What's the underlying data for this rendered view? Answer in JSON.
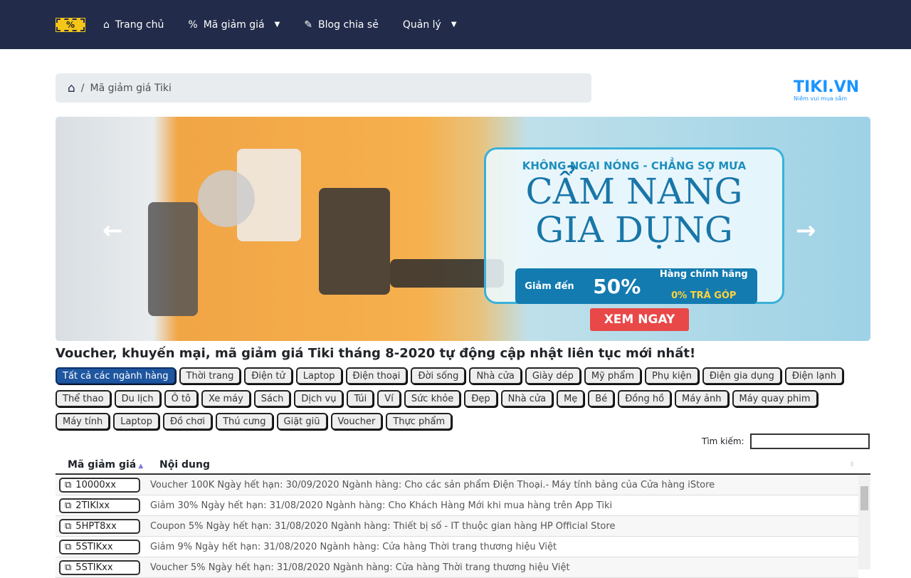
{
  "nav": {
    "logo": "%",
    "items": [
      {
        "label": "Trang chủ",
        "icon": "home-icon"
      },
      {
        "label": "Mã giảm giá",
        "icon": "percent-icon",
        "dropdown": true
      },
      {
        "label": "Blog chia sẻ",
        "icon": "blog-icon"
      },
      {
        "label": "Quản lý",
        "dropdown": true
      }
    ]
  },
  "breadcrumb": {
    "separator": "/",
    "current": "Mã giảm giá Tiki"
  },
  "brand": {
    "name": "TIKI.VN",
    "slogan": "Niềm vui mua sắm"
  },
  "banner": {
    "line1": "KHÔNG NGẠI NÓNG - CHẲNG SỢ MƯA",
    "line2": "CẨM NANG",
    "line3": "GIA DỤNG",
    "discount_prefix": "Giảm đến",
    "discount": "50%",
    "genuine": "Hàng chính hãng",
    "installment": "0% TRẢ GÓP",
    "cta": "XEM NGAY",
    "prev": "←",
    "next": "→"
  },
  "heading": "Voucher, khuyến mại, mã giảm giá Tiki tháng 8-2020 tự động cập nhật liên tục mới nhất!",
  "tags": [
    "Tất cả các ngành hàng",
    "Thời trang",
    "Điện tử",
    "Laptop",
    "Điện thoại",
    "Đời sống",
    "Nhà cửa",
    "Giày dép",
    "Mỹ phẩm",
    "Phụ kiện",
    "Điện gia dụng",
    "Điện lạnh",
    "Thể thao",
    "Du lịch",
    "Ô tô",
    "Xe máy",
    "Sách",
    "Dịch vụ",
    "Túi",
    "Ví",
    "Sức khỏe",
    "Đẹp",
    "Nhà cửa",
    "Mẹ",
    "Bé",
    "Đồng hồ",
    "Máy ảnh",
    "Máy quay phim",
    "Máy tính",
    "Laptop",
    "Đồ chơi",
    "Thú cưng",
    "Giặt giũ",
    "Voucher",
    "Thực phẩm"
  ],
  "active_tag": "Tất cả các ngành hàng",
  "search": {
    "label": "Tìm kiếm:",
    "value": ""
  },
  "table": {
    "columns": [
      "Mã giảm giá",
      "Nội dung"
    ],
    "rows": [
      {
        "code": "10000xx",
        "content": "Voucher 100K Ngày hết hạn: 30/09/2020 Ngành hàng: Cho các sản phẩm Điện Thoại.- Máy tính bảng của Cửa hàng iStore"
      },
      {
        "code": "2TIKIxx",
        "content": "Giảm 30% Ngày hết hạn: 31/08/2020 Ngành hàng: Cho Khách Hàng Mới khi mua hàng trên App Tiki"
      },
      {
        "code": "5HPT8xx",
        "content": "Coupon 5% Ngày hết hạn: 31/08/2020 Ngành hàng: Thiết bị số - IT thuộc gian hàng HP Official Store"
      },
      {
        "code": "5STIKxx",
        "content": "Giảm 9% Ngày hết hạn: 31/08/2020 Ngành hàng: Cửa hàng Thời trang thương hiệu Việt"
      },
      {
        "code": "5STIKxx",
        "content": "Voucher 5% Ngày hết hạn: 31/08/2020 Ngành hàng: Cửa hàng Thời trang thương hiệu Việt"
      }
    ]
  },
  "colors": {
    "nav": "#222c4a",
    "active_tag": "#1e56a0",
    "cta": "#e84848"
  }
}
